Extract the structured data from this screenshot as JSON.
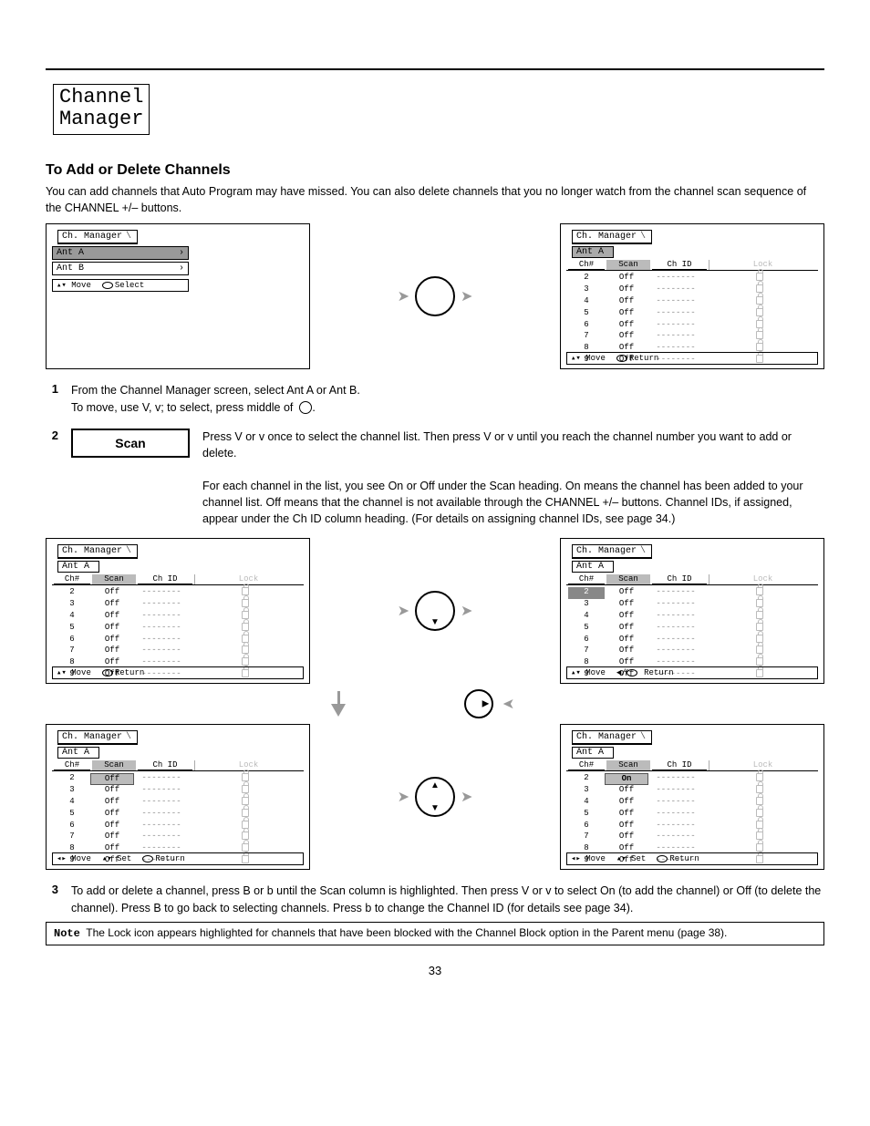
{
  "page_number": "33",
  "chapter": {
    "line1": "Channel",
    "line2": "Manager"
  },
  "section_title": "To Add or Delete Channels",
  "intro_text": "You can add channels that Auto Program may have missed. You can also delete channels that you no longer watch from the channel scan sequence of the CHANNEL +/– buttons.",
  "steps": {
    "s1": {
      "num": "1",
      "text": "From the Channel Manager screen, select Ant A or Ant B.",
      "hint": "To move, use V, v; to select, press middle of"
    },
    "s2": {
      "num": "2",
      "label": "Scan",
      "text_a": "Press V or v once to select the channel list. Then press V or v until you reach the channel number you want to add or delete.",
      "text_b": "For each channel in the list, you see On or Off under the Scan heading. On means the channel has been added to your channel list. Off means that the channel is not available through the CHANNEL +/– buttons. Channel IDs, if assigned, appear under the Ch ID column heading. (For details on assigning channel IDs, see page 34.)"
    },
    "s3": {
      "num": "3",
      "text_a": "To add or delete a channel, press B or b until the Scan column is highlighted. Then press V or v to select On (to add the channel) or Off (to delete the channel). Press B to go back to selecting channels. Press b to change the Channel ID (for details see page 34)."
    }
  },
  "note": {
    "label": "Note",
    "text": "The Lock icon appears highlighted for channels that have been blocked with the Channel Block option in the Parent menu (page 38)."
  },
  "glyphs": {
    "up": "▲",
    "down": "▼",
    "left": "◀",
    "right": "▶",
    "lrarrows": "◂▸",
    "udarrows": "▴▾"
  },
  "panels": {
    "title": "Ch. Manager",
    "antA": "Ant A",
    "antB": "Ant B",
    "move": "Move",
    "select": "Select",
    "ret": "Return",
    "set": "Set",
    "headers": {
      "ch": "Ch#",
      "scan": "Scan",
      "chid": "Ch ID",
      "lock": "Lock"
    },
    "blank_chid": "--------",
    "p1": {
      "channels": [
        "2",
        "3",
        "4",
        "5",
        "6",
        "7",
        "8",
        "9"
      ],
      "scan": [
        "Off",
        "Off",
        "Off",
        "Off",
        "Off",
        "Off",
        "Off",
        "Off"
      ]
    },
    "p4_scan": [
      "On",
      "Off",
      "Off",
      "Off",
      "Off",
      "Off",
      "Off",
      "Off"
    ]
  },
  "joystick_center_hint": "."
}
